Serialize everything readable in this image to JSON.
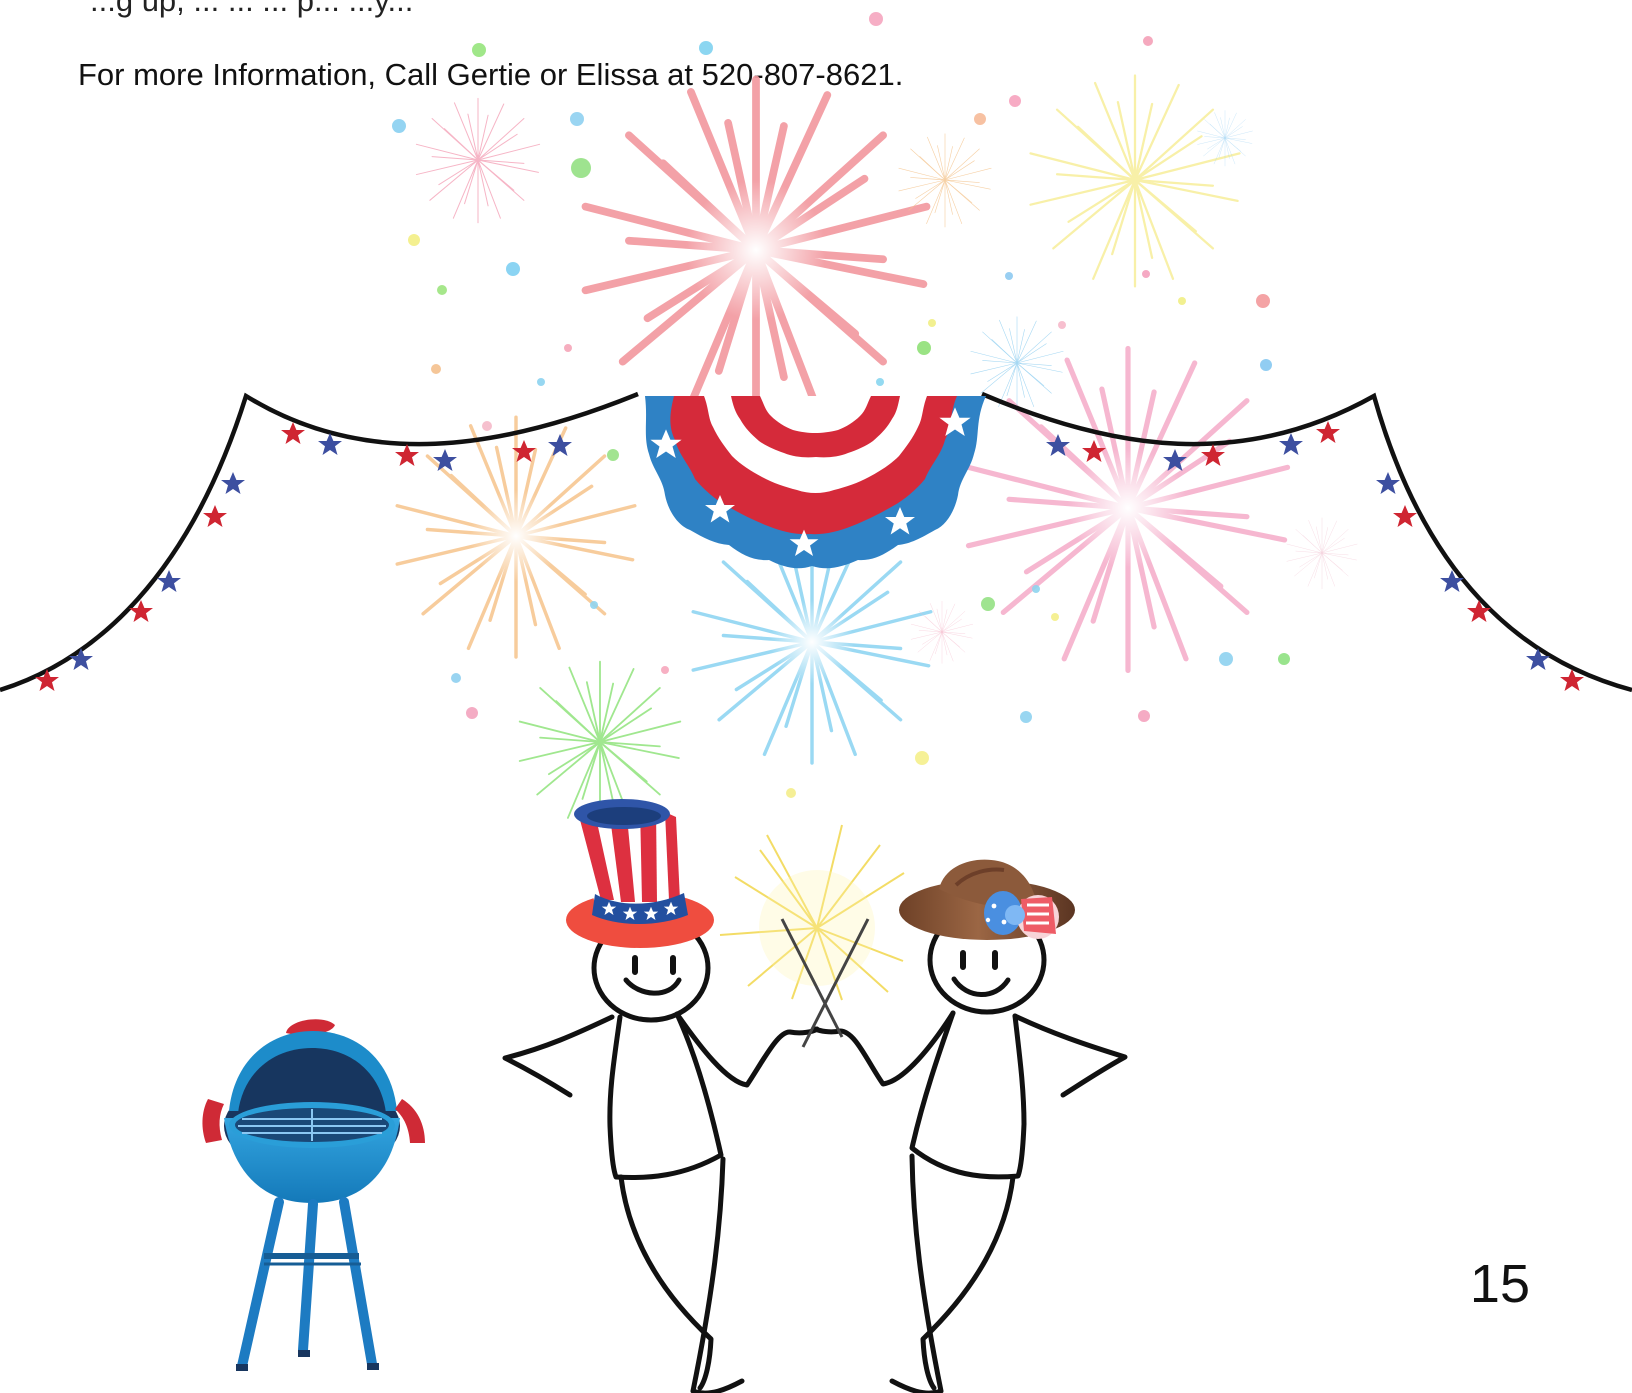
{
  "document": {
    "partial_top_text": "...g up, ... ... ... p... ...y...",
    "info_line": "For more Information, Call Gertie or Elissa at 520-807-8621.",
    "page_number": "15"
  },
  "illustration": {
    "icons": [
      "fireworks-icon",
      "star-garland-icon",
      "patriotic-bunting-icon",
      "top-hat-icon",
      "cowboy-hat-icon",
      "sparkler-icon",
      "grill-icon",
      "stick-figure-icon"
    ],
    "colors": {
      "red": "#d52a3a",
      "blue": "#2f6eb7",
      "navy": "#3f4f9c",
      "white": "#ffffff",
      "pink": "#f2a7bf",
      "light_blue": "#8fd2ef",
      "yellow": "#f1df66",
      "green": "#8ce07a",
      "orange": "#f4c28f",
      "grill_blue": "#1f8ccb",
      "grill_dark": "#173a66",
      "hat_brown": "#8b5a3c",
      "black": "#111111"
    }
  }
}
